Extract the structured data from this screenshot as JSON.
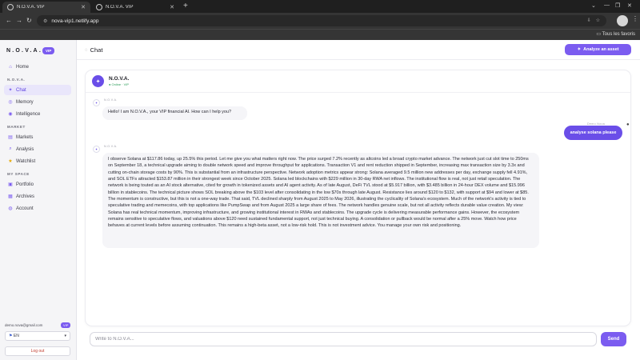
{
  "browser": {
    "tabs": [
      {
        "title": "N.O.V.A. VIP",
        "active": true
      },
      {
        "title": "N.O.V.A. VIP",
        "active": false
      }
    ],
    "url": "nova-vip1.netlify.app",
    "all_bookmarks": "Tous les favoris"
  },
  "sidebar": {
    "logo": "N.O.V.A.",
    "vip_badge": "VIP",
    "home": "Home",
    "section_nova": "N.O.V.A.",
    "chat": "Chat",
    "memory": "Memory",
    "intelligence": "Intelligence",
    "section_market": "MARKET",
    "markets": "Markets",
    "analysis": "Analysis",
    "watchlist": "Watchlist",
    "section_myspace": "MY SPACE",
    "portfolio": "Portfolio",
    "archives": "Archives",
    "account": "Account",
    "user_email": "demo.nova@gmail.com",
    "user_badge": "VIP",
    "language": "EN",
    "logout": "Log out"
  },
  "main": {
    "title": "Chat",
    "analyze_button": "Analyze an asset",
    "assistant": {
      "name": "N.O.V.A.",
      "status": "● Online · VIP"
    },
    "messages": [
      {
        "role": "assistant",
        "meta": "N.O.V.A.",
        "text": "Hello! I am N.O.V.A., your VIP financial AI. How can I help you?"
      },
      {
        "role": "user",
        "meta": "Demo Nova",
        "text": "analyse solana please"
      },
      {
        "role": "assistant",
        "meta": "N.O.V.A.",
        "text": "I observe Solana at $117.86 today, up 25.5% this period. Let me give you what matters right now. The price surged 7.2% recently as altcoins led a broad crypto market advance. The network just cut slot time to 250ms on September 18, a technical upgrade aiming to double network speed and improve throughput for applications. Transaction V1 and rent reduction shipped in September, increasing max transaction size by 3.3x and cutting on-chain storage costs by 90%. This is substantial from an infrastructure perspective. Network adoption metrics appear strong: Solana averaged 9.5 million new addresses per day, exchange supply fell 4.91%, and SOL ETFs attracted $153.87 million in their strongest week since October 2025. Solana led blockchains with $229 million in 30-day RWA net inflows. The institutional flow is real, not just retail speculation. The network is being touted as an AI stock alternative, cited for growth in tokenized assets and AI agent activity. As of late August, DeFi TVL stood at $5.917 billion, with $3.485 billion in 24-hour DEX volume and $15.996 billion in stablecoins. The technical picture shows SOL breaking above the $103 level after consolidating in the low $70s through late August. Resistance lies around $120 to $132, with support at $94 and lower at $85. The momentum is constructive, but this is not a one-way trade. That said, TVL declined sharply from August 2025 to May 2026, illustrating the cyclicality of Solana's ecosystem. Much of the network's activity is tied to speculative trading and memecoins, with top applications like PumpSwap and from August 2025 a large share of fees. The network handles genuine scale, but not all activity reflects durable value creation. My view: Solana has real technical momentum, improving infrastructure, and growing institutional interest in RWAs and stablecoins. The upgrade cycle is delivering measurable performance gains. However, the ecosystem remains sensitive to speculative flows, and valuations above $120 need sustained fundamental support, not just technical buying. A consolidation or pullback would be normal after a 25% move. Watch how price behaves at current levels before assuming continuation. This remains a high-beta asset, not a low-risk hold. This is not investment advice. You manage your own risk and positioning."
      }
    ],
    "input_placeholder": "Write to N.O.V.A...",
    "send_button": "Send"
  },
  "colors": {
    "accent": "#7b5cf0",
    "user_bubble": "#6a4ee8",
    "sidebar_bg": "#f5f5f7",
    "online": "#2e9e5b"
  }
}
